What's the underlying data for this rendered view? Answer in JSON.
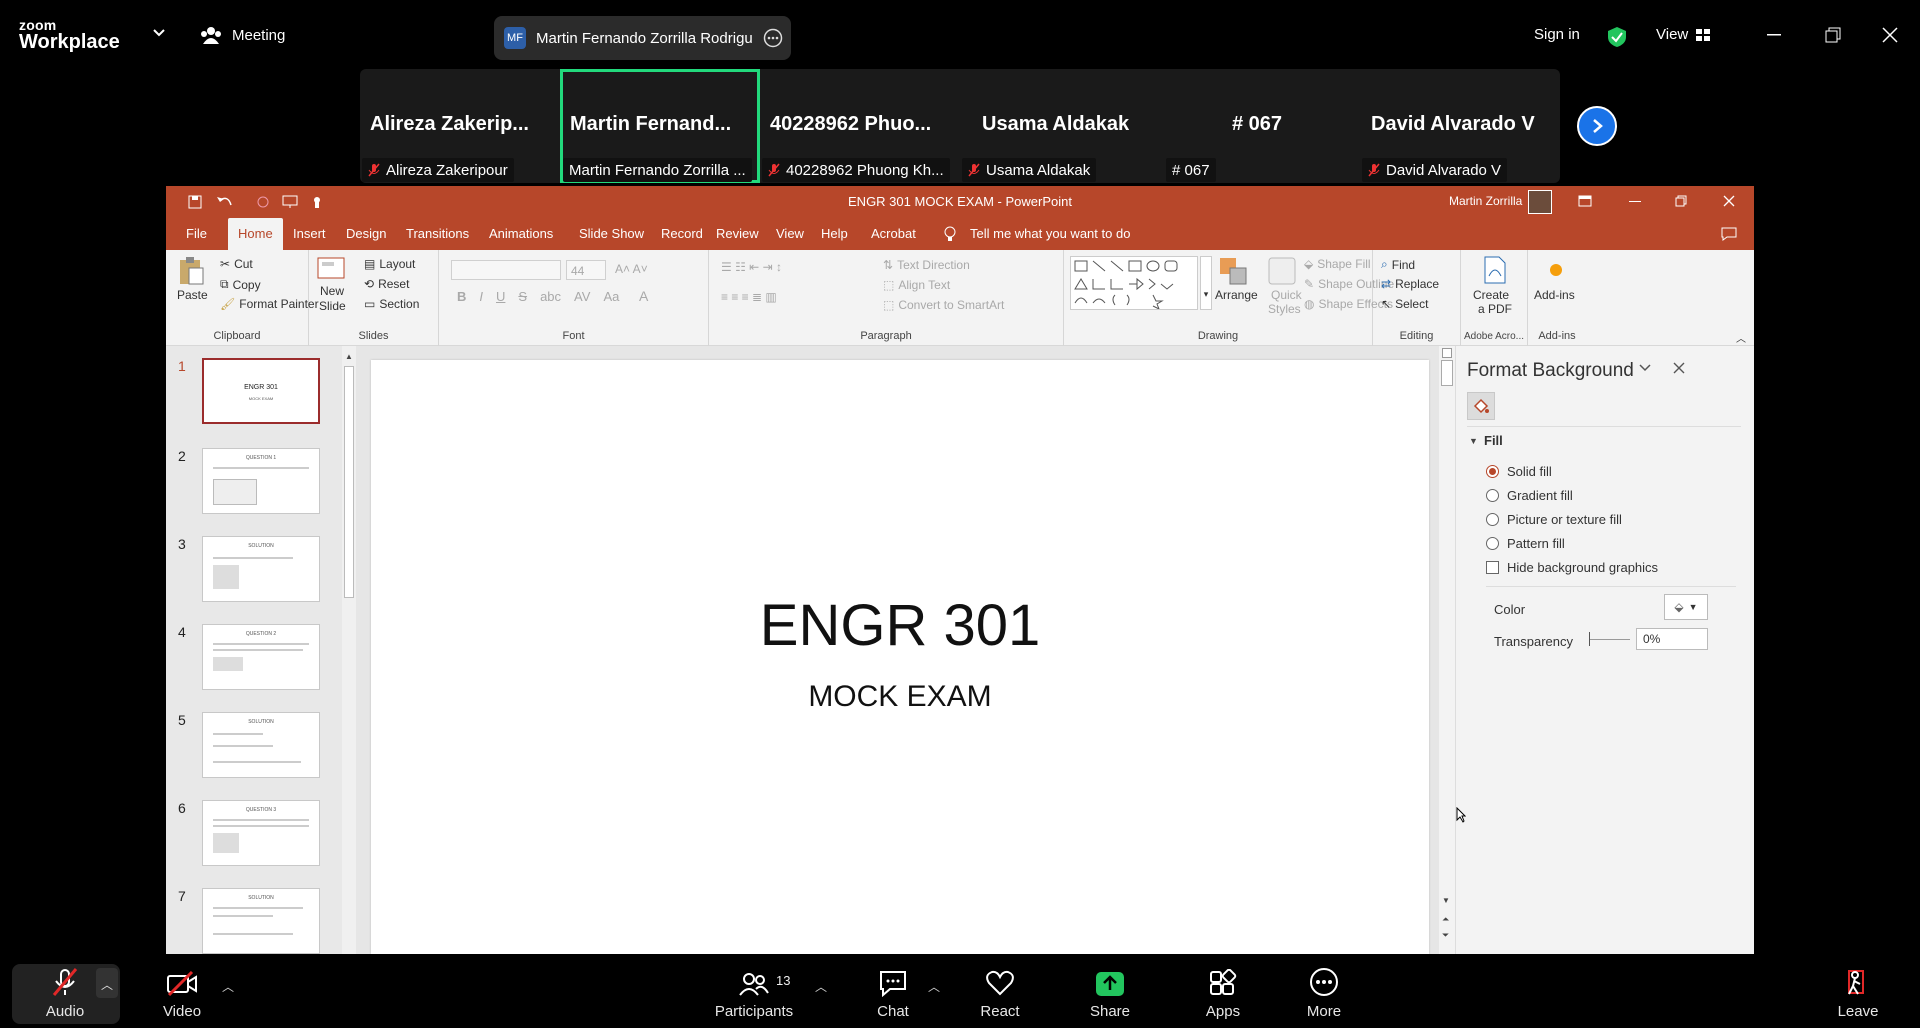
{
  "zoom": {
    "logo_line1": "zoom",
    "logo_line2": "Workplace",
    "meeting_label": "Meeting",
    "speaker_initials": "MF",
    "speaker_name": "Martin Fernando Zorrilla Rodrigu",
    "sign_in": "Sign in",
    "view_label": "View",
    "accent_green": "#22d97c",
    "accent_blue": "#1a73e8"
  },
  "gallery": {
    "tiles": [
      {
        "display": "Alireza  Zakerip...",
        "name": "Alireza Zakeripour",
        "muted": true
      },
      {
        "display": "Martin  Fernand...",
        "name": "Martin Fernando Zorrilla ...",
        "muted": false
      },
      {
        "display": "40228962  Phuo...",
        "name": "40228962 Phuong Kh...",
        "muted": true
      },
      {
        "display": "Usama Aldakak",
        "name": "Usama Aldakak",
        "muted": true
      },
      {
        "display": "# 067",
        "name": "# 067",
        "muted": false
      },
      {
        "display": "David Alvarado V",
        "name": "David Alvarado V",
        "muted": true
      }
    ]
  },
  "ppt": {
    "window_title": "ENGR 301 MOCK EXAM  -  PowerPoint",
    "user": "Martin Zorrilla",
    "tabs": [
      "File",
      "Home",
      "Insert",
      "Design",
      "Transitions",
      "Animations",
      "Slide Show",
      "Record",
      "Review",
      "View",
      "Help",
      "Acrobat"
    ],
    "tell_me": "Tell me what you want to do",
    "ribbon": {
      "paste": "Paste",
      "cut": "Cut",
      "copy": "Copy",
      "format_painter": "Format Painter",
      "clipboard": "Clipboard",
      "new_slide_1": "New",
      "new_slide_2": "Slide",
      "layout": "Layout",
      "reset": "Reset",
      "section": "Section",
      "slides": "Slides",
      "font_size": "44",
      "font": "Font",
      "paragraph": "Paragraph",
      "text_direction": "Text Direction",
      "align_text": "Align Text",
      "convert_smartart": "Convert to SmartArt",
      "arrange": "Arrange",
      "quick_styles_1": "Quick",
      "quick_styles_2": "Styles",
      "shape_fill": "Shape Fill",
      "shape_outline": "Shape Outline",
      "shape_effects": "Shape Effects",
      "drawing": "Drawing",
      "find": "Find",
      "replace": "Replace",
      "select": "Select",
      "editing": "Editing",
      "create_pdf_1": "Create",
      "create_pdf_2": "a PDF",
      "adobe": "Adobe Acro...",
      "addins": "Add-ins",
      "addins_group": "Add-ins"
    },
    "slide_numbers": [
      "1",
      "2",
      "3",
      "4",
      "5",
      "6",
      "7"
    ],
    "thumb_titles": [
      "ENGR 301",
      "QUESTION 1",
      "SOLUTION",
      "QUESTION 2",
      "SOLUTION",
      "QUESTION 3",
      "SOLUTION"
    ],
    "thumb1_sub": "MOCK EXAM",
    "slide_title": "ENGR 301",
    "slide_subtitle": "MOCK EXAM",
    "pane": {
      "title": "Format Background",
      "section": "Fill",
      "options": [
        "Solid fill",
        "Gradient fill",
        "Picture or texture fill",
        "Pattern fill"
      ],
      "selected": "Solid fill",
      "hide_bg": "Hide background graphics",
      "color_label": "Color",
      "transparency_label": "Transparency",
      "transparency_value": "0%"
    },
    "accent": "#b7472a"
  },
  "toolbar": {
    "audio": "Audio",
    "video": "Video",
    "participants": "Participants",
    "participant_count": "13",
    "chat": "Chat",
    "react": "React",
    "share": "Share",
    "apps": "Apps",
    "more": "More",
    "leave": "Leave"
  }
}
